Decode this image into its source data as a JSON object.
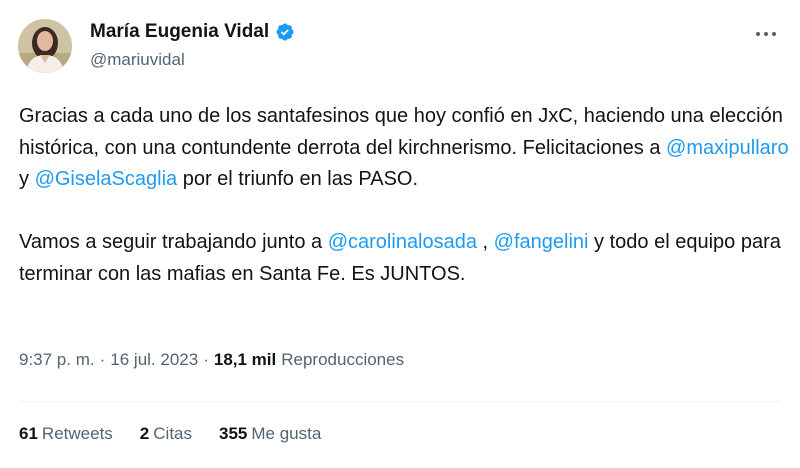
{
  "author": {
    "name": "María Eugenia Vidal",
    "handle": "@mariuvidal",
    "verified_icon": "verified-badge-icon"
  },
  "tweet": {
    "p1_part1": "Gracias a cada uno de los santafesinos que hoy confió en JxC, haciendo una elección histórica, con una contundente derrota del kirchnerismo. Felicitaciones a ",
    "mention1": "@maxipullaro",
    "p1_part2": " y ",
    "mention2": "@GiselaScaglia",
    "p1_part3": " por el triunfo en las PASO.",
    "p2_part1": "Vamos a seguir trabajando junto a ",
    "mention3": "@carolinalosada",
    "p2_part2": " , ",
    "mention4": "@fangelini",
    "p2_part3": " y todo el equipo para terminar con las mafias en Santa Fe. Es JUNTOS."
  },
  "meta": {
    "time": "9:37 p. m.",
    "sep1": "·",
    "date": "16 jul. 2023",
    "sep2": "·",
    "views_count": "18,1 mil",
    "views_label": "Reproducciones"
  },
  "stats": {
    "retweets_count": "61",
    "retweets_label": "Retweets",
    "quotes_count": "2",
    "quotes_label": "Citas",
    "likes_count": "355",
    "likes_label": "Me gusta"
  },
  "colors": {
    "accent": "#1d9bf0",
    "text": "#0f1419",
    "secondary": "#536471"
  }
}
